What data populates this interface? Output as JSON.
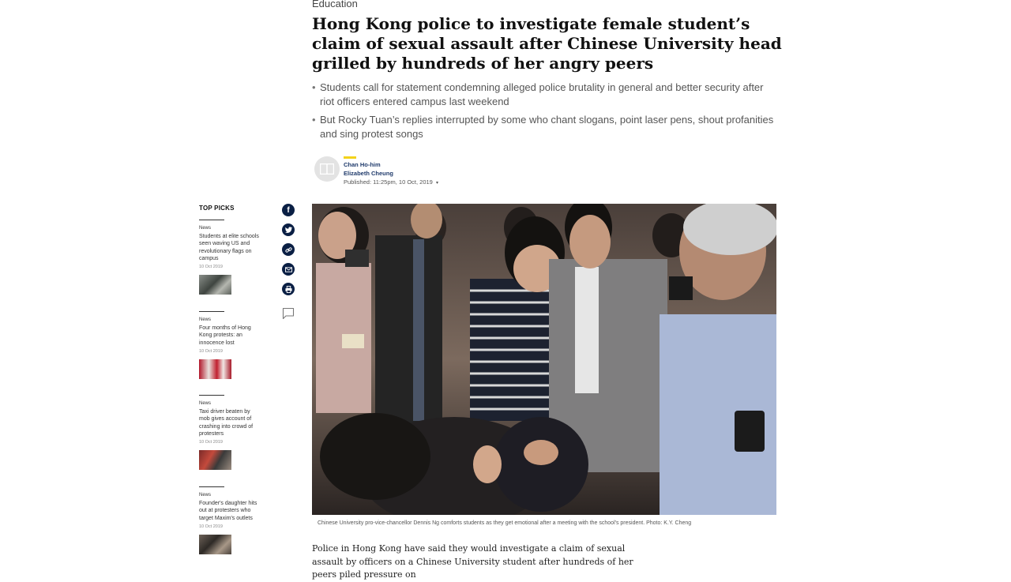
{
  "article": {
    "section": "Education",
    "headline": "Hong Kong police to investigate female student’s claim of sexual assault after Chinese University head grilled by hundreds of her angry peers",
    "summary": [
      "Students call for statement condemning alleged police brutality in general and better security after riot officers entered campus last weekend",
      "But Rocky Tuan’s replies interrupted by some who chant slogans, point laser pens, shout profanities and sing protest songs"
    ],
    "bullet": "•",
    "authors": [
      "Chan Ho-him",
      "Elizabeth Cheung"
    ],
    "published": "Published: 11:25pm, 10 Oct, 2019",
    "caption": "Chinese University pro-vice-chancellor Dennis Ng comforts students as they get emotional after a meeting with the school's president. Photo: K.Y. Cheng",
    "body": "Police in Hong Kong have said they would investigate a claim of sexual assault by officers on a Chinese University student after hundreds of her peers piled pressure on"
  },
  "sidebar": {
    "heading": "TOP PICKS",
    "picks": [
      {
        "category": "News",
        "title": "Students at elite schools seen waving US and revolutionary flags on campus",
        "date": "10 Oct 2019"
      },
      {
        "category": "News",
        "title": "Four months of Hong Kong protests: an innocence lost",
        "date": "10 Oct 2019"
      },
      {
        "category": "News",
        "title": "Taxi driver beaten by mob gives account of crashing into crowd of protesters",
        "date": "10 Oct 2019"
      },
      {
        "category": "News",
        "title": "Founder's daughter hits out at protesters who target Maxim's outlets",
        "date": "10 Oct 2019"
      }
    ]
  },
  "share": {
    "icons": [
      "facebook-icon",
      "twitter-icon",
      "link-icon",
      "email-icon",
      "print-icon",
      "comment-icon"
    ]
  },
  "colors": {
    "navy": "#0a1f44",
    "byline_accent": "#f3d31b",
    "author_blue": "#1f3a6b"
  }
}
